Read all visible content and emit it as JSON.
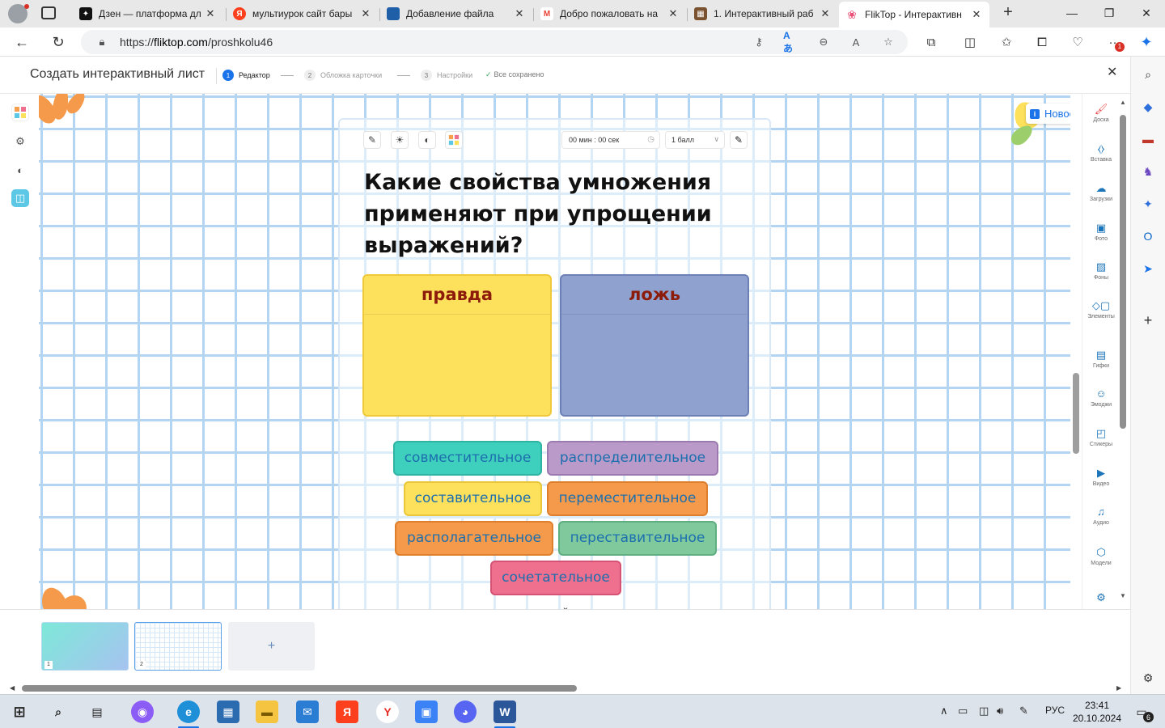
{
  "browser": {
    "tabs": [
      {
        "title": "Дзен — платформа дл",
        "icon": "dzen-icon",
        "color": "#111111",
        "glyph": "✦"
      },
      {
        "title": "мультиурок сайт бары",
        "icon": "yandex-icon",
        "color": "#fc3f1d",
        "glyph": "Я"
      },
      {
        "title": "Добавление файла",
        "icon": "book-icon",
        "color": "#1f5fa8",
        "glyph": "▮"
      },
      {
        "title": "Добро пожаловать на",
        "icon": "gmail-icon",
        "color": "#ea4335",
        "glyph": "M"
      },
      {
        "title": "1. Интерактивный раб",
        "icon": "worksheet-icon",
        "color": "#7a5230",
        "glyph": "▦"
      },
      {
        "title": "FlikTop - Интерактивн",
        "icon": "fliktop-icon",
        "color": "#e94e77",
        "glyph": "❀"
      }
    ],
    "new_tab": "+",
    "url_prefix": "https://",
    "url_host": "fliktop.com",
    "url_path": "/proshkolu46",
    "notif_badge": "1"
  },
  "topbar": {
    "title": "Создать интерактивный лист",
    "steps": [
      {
        "num": "1",
        "label": "Редактор"
      },
      {
        "num": "2",
        "label": "Обложка карточки"
      },
      {
        "num": "3",
        "label": "Настройки"
      }
    ],
    "saved": "Все сохранено"
  },
  "card": {
    "timer": "00 мин : 00 сек",
    "points": "1 балл",
    "question": "Какие свойства умножения применяют при упрощении выражений?",
    "categories": [
      "правда",
      "ложь"
    ],
    "chips": [
      {
        "text": "совместительное",
        "bg": "#3fcfbd",
        "border": "#2fb3a2"
      },
      {
        "text": "распределительное",
        "bg": "#b99ac9",
        "border": "#9c7ab0"
      },
      {
        "text": "составительное",
        "bg": "#fde05c",
        "border": "#e9c63a"
      },
      {
        "text": "переместительное",
        "bg": "#f59a4a",
        "border": "#dd7f2c"
      },
      {
        "text": "располагательное",
        "bg": "#f59a4a",
        "border": "#dd7f2c"
      },
      {
        "text": "переставительное",
        "bg": "#7fc99d",
        "border": "#5eae7f"
      },
      {
        "text": "сочетательное",
        "bg": "#ef6f8f",
        "border": "#d65274"
      }
    ]
  },
  "new_badge": "Новое",
  "right_tools": [
    "Доска",
    "Вставка",
    "Загрузки",
    "Фото",
    "Фоны",
    "Элементы",
    "Гифки",
    "Эмоджи",
    "Стикеры",
    "Видео",
    "Аудио",
    "Модели"
  ],
  "slides": [
    "1",
    "2"
  ],
  "add_slide": "+",
  "taskbar": {
    "lang": "РУС",
    "time": "23:41",
    "date": "20.10.2024",
    "notifications": "6"
  }
}
